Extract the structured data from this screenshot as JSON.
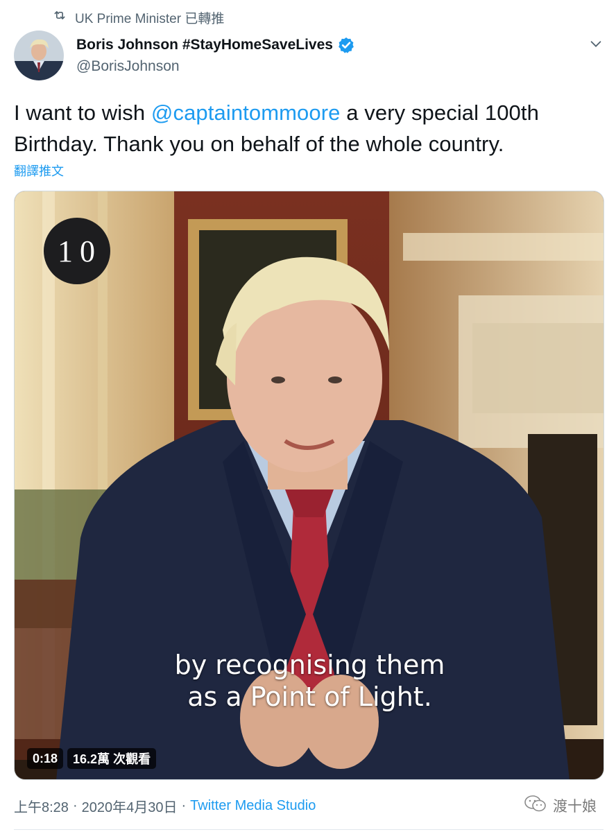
{
  "retweet": {
    "icon": "retweet-icon",
    "label": "UK Prime Minister 已轉推"
  },
  "author": {
    "display_name": "Boris Johnson #StayHomeSaveLives",
    "handle": "@BorisJohnson",
    "verified": true,
    "verified_color": "#1d9bf0"
  },
  "tweet": {
    "text_before": "I want to wish ",
    "mention": "@captaintommoore",
    "text_after": " a very special 100th Birthday. Thank you on behalf of the whole country.",
    "translate_label": "翻譯推文"
  },
  "media": {
    "logo_text": "10",
    "subtitle_line1": "by recognising them",
    "subtitle_line2": "as a Point of Light.",
    "duration": "0:18",
    "views": "16.2萬 次觀看"
  },
  "footer": {
    "time": "上午8:28",
    "separator": "·",
    "date": "2020年4月30日",
    "source": "Twitter Media Studio"
  },
  "watermark": {
    "icon": "wechat-icon",
    "label": "渡十娘"
  },
  "colors": {
    "accent": "#1d9bf0",
    "secondary_text": "#536471"
  }
}
